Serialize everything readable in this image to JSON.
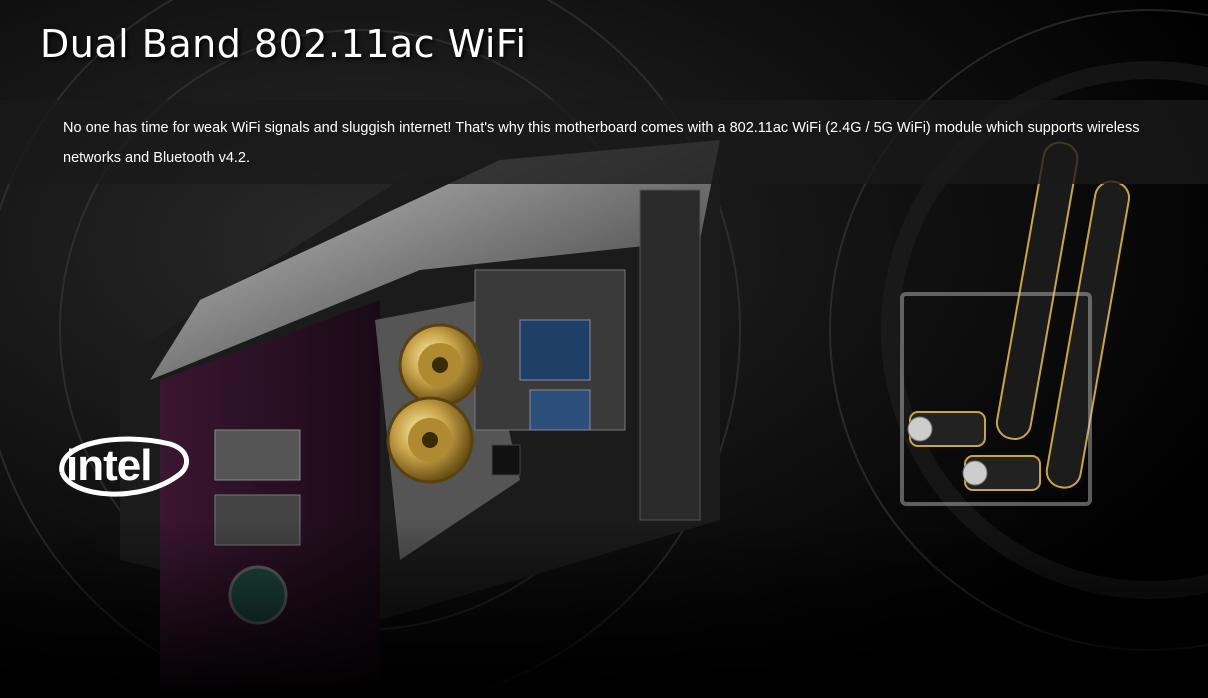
{
  "header": {
    "title": "Dual Band 802.11ac WiFi"
  },
  "description": {
    "text": "No one has time for weak WiFi signals and sluggish internet! That's why this motherboard comes with a 802.11ac WiFi (2.4G / 5G WiFi) module which supports wireless networks and Bluetooth v4.2."
  },
  "logo": {
    "brand": "intel",
    "registered": "®"
  },
  "icons": {
    "motherboard": "motherboard-io-panel-icon",
    "antennas": "wifi-antenna-icon"
  },
  "colors": {
    "background": "#000000",
    "text": "#ffffff",
    "gold": "#c9a44a",
    "pcb_purple": "#3a1630"
  }
}
